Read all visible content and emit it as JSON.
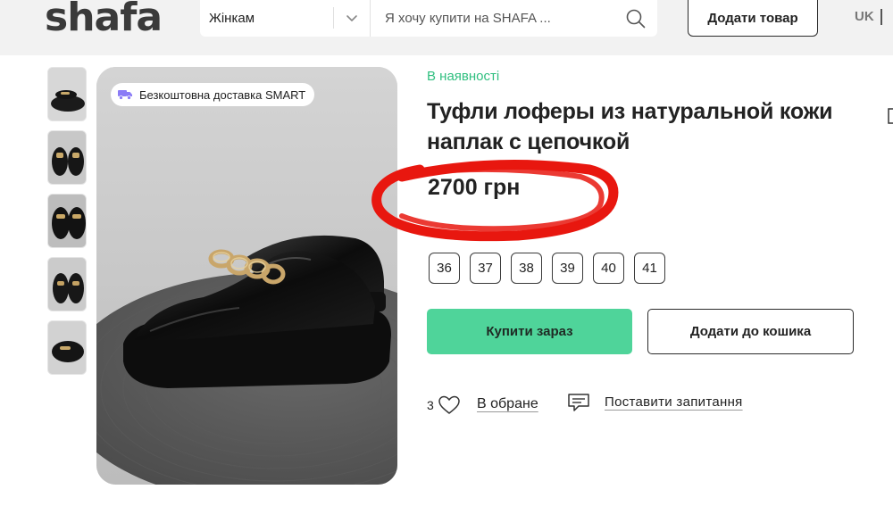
{
  "header": {
    "logo": "shafa",
    "category": "Жінкам",
    "search_placeholder": "Я хочу купити на SHAFA ...",
    "add_item_label": "Додати товар",
    "language": "UK"
  },
  "gallery": {
    "thumbnail_count": 5,
    "delivery_badge": "Безкоштовна доставка SMART"
  },
  "product": {
    "availability": "В наявності",
    "title": "Туфли лоферы из натуральной кожи наплак с цепочкой",
    "price": "2700 грн",
    "sizes": [
      "36",
      "37",
      "38",
      "39",
      "40",
      "41"
    ],
    "buy_label": "Купити зараз",
    "cart_label": "Додати до кошика",
    "favorites_count": "3",
    "favorites_label": "В обране",
    "ask_label": "Поставити запитання"
  },
  "colors": {
    "accent_green": "#4fd49a",
    "availability_green": "#2fbf7f",
    "highlight_red": "#e8170f",
    "header_bg": "#f2f2f2"
  },
  "icons": [
    "truck-icon",
    "search-icon",
    "chevron-down-icon",
    "heart-icon",
    "chat-icon"
  ]
}
